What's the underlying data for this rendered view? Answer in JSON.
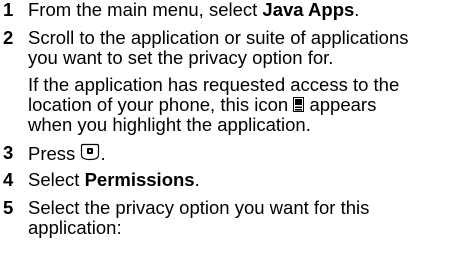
{
  "steps": [
    {
      "num": "1",
      "pre": "From the main menu, select ",
      "bold": "Java Apps",
      "post": "."
    },
    {
      "num": "2",
      "line1": "Scroll to the application or suite of applications",
      "line2": "you want to set the privacy option for.",
      "note_line1": "If the application has requested access to the",
      "note_line2_pre": "location of your phone, this icon",
      "note_line2_post": "appears",
      "note_line3": "when you highlight the application."
    },
    {
      "num": "3",
      "pre": "Press",
      "post": "."
    },
    {
      "num": "4",
      "pre": "Select ",
      "bold": "Permissions",
      "post": "."
    },
    {
      "num": "5",
      "line1": "Select the privacy option you want for this",
      "line2": "application:"
    }
  ],
  "icons": {
    "location_icon": "location-access-icon",
    "select_key_icon": "select-key-icon"
  }
}
